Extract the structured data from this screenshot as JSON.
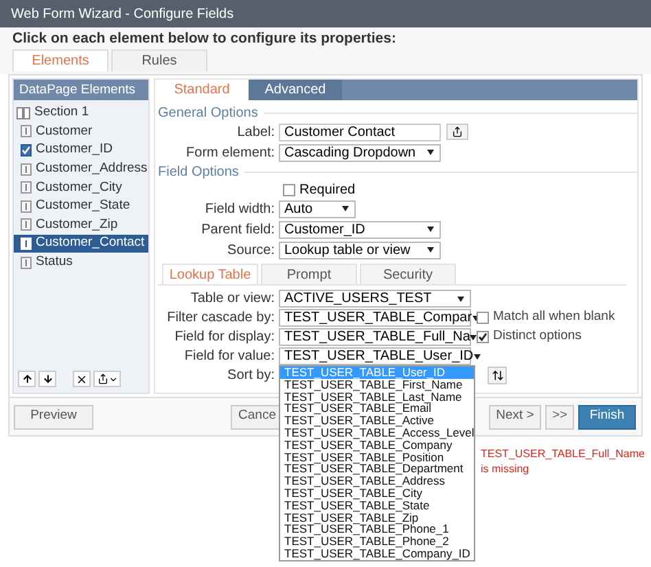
{
  "window": {
    "title": "Web Form Wizard - Configure Fields"
  },
  "instruction": "Click on each element below to configure its properties:",
  "tabs": [
    {
      "label": "Elements",
      "selected": true
    },
    {
      "label": "Rules",
      "selected": false
    }
  ],
  "sidebar": {
    "title": "DataPage Elements",
    "items": [
      {
        "label": "Section 1",
        "kind": "section",
        "selected": false
      },
      {
        "label": "Customer",
        "kind": "field",
        "selected": false
      },
      {
        "label": "Customer_ID",
        "kind": "key",
        "selected": false
      },
      {
        "label": "Customer_Address",
        "kind": "field",
        "selected": false
      },
      {
        "label": "Customer_City",
        "kind": "field",
        "selected": false
      },
      {
        "label": "Customer_State",
        "kind": "field",
        "selected": false
      },
      {
        "label": "Customer_Zip",
        "kind": "field",
        "selected": false
      },
      {
        "label": "Customer_Contact",
        "kind": "field",
        "selected": true
      },
      {
        "label": "Status",
        "kind": "field",
        "selected": false
      }
    ]
  },
  "panel_tabs": [
    {
      "label": "Standard",
      "selected": true
    },
    {
      "label": "Advanced",
      "selected": false
    }
  ],
  "general_options": {
    "title": "General Options",
    "rows": [
      {
        "label": "Label:",
        "kind": "input",
        "value": "Customer Contact"
      },
      {
        "label": "Form element:",
        "kind": "select",
        "value": "Cascading Dropdown"
      }
    ]
  },
  "field_options": {
    "title": "Field Options",
    "required": {
      "label": "Required",
      "checked": false
    },
    "rows": [
      {
        "label": "Field width:",
        "kind": "small-select",
        "value": "Auto"
      },
      {
        "label": "Parent field:",
        "kind": "select",
        "value": "Customer_ID"
      },
      {
        "label": "Source:",
        "kind": "select",
        "value": "Lookup table or view"
      }
    ]
  },
  "lookup_tabs": [
    {
      "label": "Lookup Table",
      "selected": true
    },
    {
      "label": "Prompt",
      "selected": false
    },
    {
      "label": "Security",
      "selected": false
    }
  ],
  "lookup_rows": [
    {
      "label": "Table or view:",
      "kind": "select",
      "value": "ACTIVE_USERS_TEST"
    },
    {
      "label": "Filter cascade by:",
      "kind": "select",
      "value": "TEST_USER_TABLE_Compar",
      "option": {
        "label": "Match all when blank",
        "checked": false
      }
    },
    {
      "label": "Field for display:",
      "kind": "select",
      "value": "TEST_USER_TABLE_Full_Na",
      "option": {
        "label": "Distinct options",
        "checked": true
      }
    },
    {
      "label": "Field for value:",
      "kind": "open-select",
      "value": "TEST_USER_TABLE_User_ID"
    },
    {
      "label": "Sort by:",
      "kind": "sort"
    }
  ],
  "dropdown": {
    "options": [
      {
        "label": "TEST_USER_TABLE_User_ID",
        "selected": true
      },
      {
        "label": "TEST_USER_TABLE_First_Name",
        "selected": false
      },
      {
        "label": "TEST_USER_TABLE_Last_Name",
        "selected": false
      },
      {
        "label": "TEST_USER_TABLE_Email",
        "selected": false
      },
      {
        "label": "TEST_USER_TABLE_Active",
        "selected": false
      },
      {
        "label": "TEST_USER_TABLE_Access_Level",
        "selected": false
      },
      {
        "label": "TEST_USER_TABLE_Company",
        "selected": false
      },
      {
        "label": "TEST_USER_TABLE_Position",
        "selected": false
      },
      {
        "label": "TEST_USER_TABLE_Department",
        "selected": false
      },
      {
        "label": "TEST_USER_TABLE_Address",
        "selected": false
      },
      {
        "label": "TEST_USER_TABLE_City",
        "selected": false
      },
      {
        "label": "TEST_USER_TABLE_State",
        "selected": false
      },
      {
        "label": "TEST_USER_TABLE_Zip",
        "selected": false
      },
      {
        "label": "TEST_USER_TABLE_Phone_1",
        "selected": false
      },
      {
        "label": "TEST_USER_TABLE_Phone_2",
        "selected": false
      },
      {
        "label": "TEST_USER_TABLE_Company_ID",
        "selected": false
      }
    ]
  },
  "buttons": [
    {
      "label": "Preview",
      "kind": "default"
    },
    {
      "label": "Cance",
      "kind": "partial"
    },
    {
      "label": "Next >",
      "kind": "default"
    },
    {
      "label": ">>",
      "kind": "small"
    },
    {
      "label": "Finish",
      "kind": "primary"
    }
  ],
  "note": "TEST_USER_TABLE_Full_Name is missing"
}
